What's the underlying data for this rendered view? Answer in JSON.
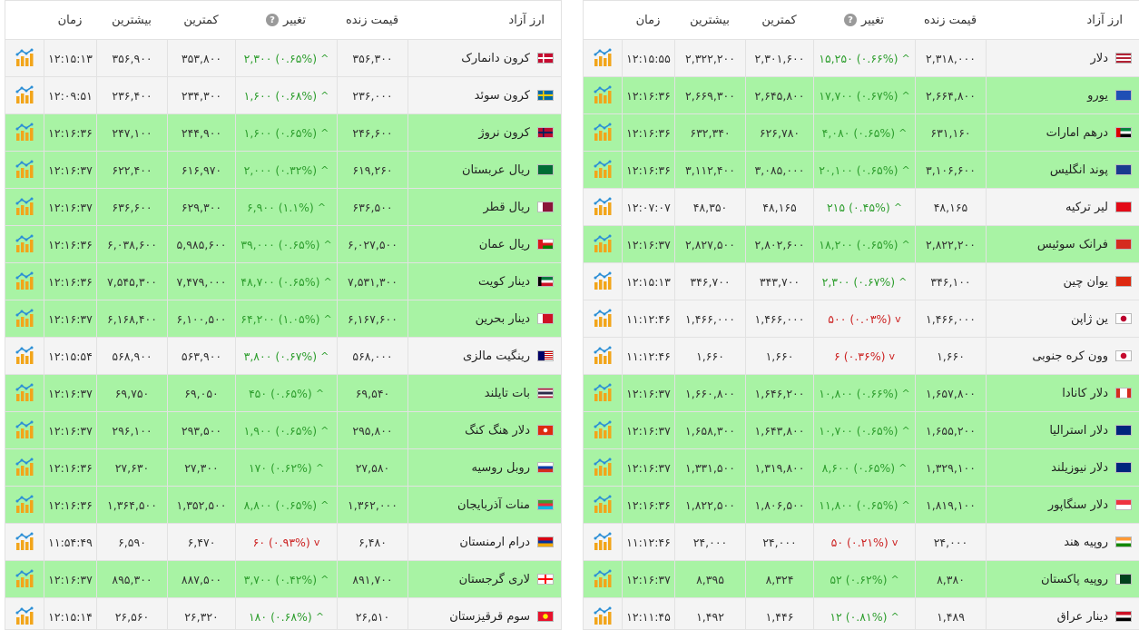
{
  "headers": {
    "name": "ارز آزاد",
    "live": "قیمت زنده",
    "change": "تغییر",
    "low": "کمترین",
    "high": "بیشترین",
    "time": "زمان"
  },
  "colors": {
    "up_row": "#a8f3a4",
    "up_text": "#2e9e2e",
    "down_text": "#cc2222",
    "flat_row": "#f4f4f4"
  },
  "right_table": [
    {
      "name": "دلار",
      "flag": "us-flag",
      "live": "۲,۳۱۸,۰۰۰",
      "change": "۱۵,۲۵۰ (۰.۶۶%)",
      "dir": "up",
      "low": "۲,۳۰۱,۶۰۰",
      "high": "۲,۳۲۲,۲۰۰",
      "time": "۱۲:۱۵:۵۵",
      "bg": "flat"
    },
    {
      "name": "یورو",
      "flag": "eu-flag",
      "live": "۲,۶۶۴,۸۰۰",
      "change": "۱۷,۷۰۰ (۰.۶۷%)",
      "dir": "up",
      "low": "۲,۶۴۵,۸۰۰",
      "high": "۲,۶۶۹,۳۰۰",
      "time": "۱۲:۱۶:۳۶",
      "bg": "up"
    },
    {
      "name": "درهم امارات",
      "flag": "ae-flag",
      "live": "۶۳۱,۱۶۰",
      "change": "۴,۰۸۰ (۰.۶۵%)",
      "dir": "up",
      "low": "۶۲۶,۷۸۰",
      "high": "۶۳۲,۳۴۰",
      "time": "۱۲:۱۶:۳۶",
      "bg": "up"
    },
    {
      "name": "پوند انگلیس",
      "flag": "gb-flag",
      "live": "۳,۱۰۶,۶۰۰",
      "change": "۲۰,۱۰۰ (۰.۶۵%)",
      "dir": "up",
      "low": "۳,۰۸۵,۰۰۰",
      "high": "۳,۱۱۲,۴۰۰",
      "time": "۱۲:۱۶:۳۶",
      "bg": "up"
    },
    {
      "name": "لیر ترکیه",
      "flag": "tr-flag",
      "live": "۴۸,۱۶۵",
      "change": "۲۱۵ (۰.۴۵%)",
      "dir": "up",
      "low": "۴۸,۱۶۵",
      "high": "۴۸,۳۵۰",
      "time": "۱۲:۰۷:۰۷",
      "bg": "flat"
    },
    {
      "name": "فرانک سوئیس",
      "flag": "ch-flag",
      "live": "۲,۸۲۲,۲۰۰",
      "change": "۱۸,۲۰۰ (۰.۶۵%)",
      "dir": "up",
      "low": "۲,۸۰۲,۶۰۰",
      "high": "۲,۸۲۷,۵۰۰",
      "time": "۱۲:۱۶:۳۷",
      "bg": "up"
    },
    {
      "name": "یوان چین",
      "flag": "cn-flag",
      "live": "۳۴۶,۱۰۰",
      "change": "۲,۳۰۰ (۰.۶۷%)",
      "dir": "up",
      "low": "۳۴۳,۷۰۰",
      "high": "۳۴۶,۷۰۰",
      "time": "۱۲:۱۵:۱۳",
      "bg": "flat"
    },
    {
      "name": "ین ژاپن",
      "flag": "jp-flag",
      "live": "۱,۴۶۶,۰۰۰",
      "change": "۵۰۰ (۰.۰۳%)",
      "dir": "down",
      "low": "۱,۴۶۶,۰۰۰",
      "high": "۱,۴۶۶,۰۰۰",
      "time": "۱۱:۱۲:۴۶",
      "bg": "flat"
    },
    {
      "name": "وون کره جنوبی",
      "flag": "kr-flag",
      "live": "۱,۶۶۰",
      "change": "۶ (۰.۳۶%)",
      "dir": "down",
      "low": "۱,۶۶۰",
      "high": "۱,۶۶۰",
      "time": "۱۱:۱۲:۴۶",
      "bg": "flat"
    },
    {
      "name": "دلار کانادا",
      "flag": "ca-flag",
      "live": "۱,۶۵۷,۸۰۰",
      "change": "۱۰,۸۰۰ (۰.۶۶%)",
      "dir": "up",
      "low": "۱,۶۴۶,۲۰۰",
      "high": "۱,۶۶۰,۸۰۰",
      "time": "۱۲:۱۶:۳۷",
      "bg": "up"
    },
    {
      "name": "دلار استرالیا",
      "flag": "au-flag",
      "live": "۱,۶۵۵,۲۰۰",
      "change": "۱۰,۷۰۰ (۰.۶۵%)",
      "dir": "up",
      "low": "۱,۶۴۳,۸۰۰",
      "high": "۱,۶۵۸,۳۰۰",
      "time": "۱۲:۱۶:۳۷",
      "bg": "up"
    },
    {
      "name": "دلار نیوزیلند",
      "flag": "nz-flag",
      "live": "۱,۳۲۹,۱۰۰",
      "change": "۸,۶۰۰ (۰.۶۵%)",
      "dir": "up",
      "low": "۱,۳۱۹,۸۰۰",
      "high": "۱,۳۳۱,۵۰۰",
      "time": "۱۲:۱۶:۳۷",
      "bg": "up"
    },
    {
      "name": "دلار سنگاپور",
      "flag": "sg-flag",
      "live": "۱,۸۱۹,۱۰۰",
      "change": "۱۱,۸۰۰ (۰.۶۵%)",
      "dir": "up",
      "low": "۱,۸۰۶,۵۰۰",
      "high": "۱,۸۲۲,۵۰۰",
      "time": "۱۲:۱۶:۳۶",
      "bg": "up"
    },
    {
      "name": "روپیه هند",
      "flag": "in-flag",
      "live": "۲۴,۰۰۰",
      "change": "۵۰ (۰.۲۱%)",
      "dir": "down",
      "low": "۲۴,۰۰۰",
      "high": "۲۴,۰۰۰",
      "time": "۱۱:۱۲:۴۶",
      "bg": "flat"
    },
    {
      "name": "روپیه پاکستان",
      "flag": "pk-flag",
      "live": "۸,۳۸۰",
      "change": "۵۲ (۰.۶۲%)",
      "dir": "up",
      "low": "۸,۳۲۴",
      "high": "۸,۳۹۵",
      "time": "۱۲:۱۶:۳۷",
      "bg": "up"
    },
    {
      "name": "دینار عراق",
      "flag": "iq-flag",
      "live": "۱,۴۸۹",
      "change": "۱۲ (۰.۸۱%)",
      "dir": "up",
      "low": "۱,۴۴۶",
      "high": "۱,۴۹۲",
      "time": "۱۲:۱۱:۴۵",
      "bg": "flat"
    }
  ],
  "left_table": [
    {
      "name": "کرون دانمارک",
      "flag": "dk-flag",
      "live": "۳۵۶,۳۰۰",
      "change": "۲,۳۰۰ (۰.۶۵%)",
      "dir": "up",
      "low": "۳۵۳,۸۰۰",
      "high": "۳۵۶,۹۰۰",
      "time": "۱۲:۱۵:۱۳",
      "bg": "flat"
    },
    {
      "name": "کرون سوئد",
      "flag": "se-flag",
      "live": "۲۳۶,۰۰۰",
      "change": "۱,۶۰۰ (۰.۶۸%)",
      "dir": "up",
      "low": "۲۳۴,۳۰۰",
      "high": "۲۳۶,۴۰۰",
      "time": "۱۲:۰۹:۵۱",
      "bg": "flat"
    },
    {
      "name": "کرون نروژ",
      "flag": "no-flag",
      "live": "۲۴۶,۶۰۰",
      "change": "۱,۶۰۰ (۰.۶۵%)",
      "dir": "up",
      "low": "۲۴۴,۹۰۰",
      "high": "۲۴۷,۱۰۰",
      "time": "۱۲:۱۶:۳۶",
      "bg": "up"
    },
    {
      "name": "ریال عربستان",
      "flag": "sa-flag",
      "live": "۶۱۹,۲۶۰",
      "change": "۲,۰۰۰ (۰.۳۲%)",
      "dir": "up",
      "low": "۶۱۶,۹۷۰",
      "high": "۶۲۲,۴۰۰",
      "time": "۱۲:۱۶:۳۷",
      "bg": "up"
    },
    {
      "name": "ریال قطر",
      "flag": "qa-flag",
      "live": "۶۳۶,۵۰۰",
      "change": "۶,۹۰۰ (۱.۱%)",
      "dir": "up",
      "low": "۶۲۹,۳۰۰",
      "high": "۶۳۶,۶۰۰",
      "time": "۱۲:۱۶:۳۷",
      "bg": "up"
    },
    {
      "name": "ریال عمان",
      "flag": "om-flag",
      "live": "۶,۰۲۷,۵۰۰",
      "change": "۳۹,۰۰۰ (۰.۶۵%)",
      "dir": "up",
      "low": "۵,۹۸۵,۶۰۰",
      "high": "۶,۰۳۸,۶۰۰",
      "time": "۱۲:۱۶:۳۶",
      "bg": "up"
    },
    {
      "name": "دینار کویت",
      "flag": "kw-flag",
      "live": "۷,۵۳۱,۳۰۰",
      "change": "۴۸,۷۰۰ (۰.۶۵%)",
      "dir": "up",
      "low": "۷,۴۷۹,۰۰۰",
      "high": "۷,۵۴۵,۳۰۰",
      "time": "۱۲:۱۶:۳۶",
      "bg": "up"
    },
    {
      "name": "دینار بحرین",
      "flag": "bh-flag",
      "live": "۶,۱۶۷,۶۰۰",
      "change": "۶۴,۲۰۰ (۱.۰۵%)",
      "dir": "up",
      "low": "۶,۱۰۰,۵۰۰",
      "high": "۶,۱۶۸,۴۰۰",
      "time": "۱۲:۱۶:۳۷",
      "bg": "up"
    },
    {
      "name": "رینگیت مالزی",
      "flag": "my-flag",
      "live": "۵۶۸,۰۰۰",
      "change": "۳,۸۰۰ (۰.۶۷%)",
      "dir": "up",
      "low": "۵۶۳,۹۰۰",
      "high": "۵۶۸,۹۰۰",
      "time": "۱۲:۱۵:۵۴",
      "bg": "flat"
    },
    {
      "name": "بات تایلند",
      "flag": "th-flag",
      "live": "۶۹,۵۴۰",
      "change": "۴۵۰ (۰.۶۵%)",
      "dir": "up",
      "low": "۶۹,۰۵۰",
      "high": "۶۹,۷۵۰",
      "time": "۱۲:۱۶:۳۷",
      "bg": "up"
    },
    {
      "name": "دلار هنگ کنگ",
      "flag": "hk-flag",
      "live": "۲۹۵,۸۰۰",
      "change": "۱,۹۰۰ (۰.۶۵%)",
      "dir": "up",
      "low": "۲۹۳,۵۰۰",
      "high": "۲۹۶,۱۰۰",
      "time": "۱۲:۱۶:۳۷",
      "bg": "up"
    },
    {
      "name": "روبل روسیه",
      "flag": "ru-flag",
      "live": "۲۷,۵۸۰",
      "change": "۱۷۰ (۰.۶۲%)",
      "dir": "up",
      "low": "۲۷,۳۰۰",
      "high": "۲۷,۶۳۰",
      "time": "۱۲:۱۶:۳۶",
      "bg": "up"
    },
    {
      "name": "منات آذربایجان",
      "flag": "az-flag",
      "live": "۱,۳۶۲,۰۰۰",
      "change": "۸,۸۰۰ (۰.۶۵%)",
      "dir": "up",
      "low": "۱,۳۵۲,۵۰۰",
      "high": "۱,۳۶۴,۵۰۰",
      "time": "۱۲:۱۶:۳۶",
      "bg": "up"
    },
    {
      "name": "درام ارمنستان",
      "flag": "am-flag",
      "live": "۶,۴۸۰",
      "change": "۶۰ (۰.۹۳%)",
      "dir": "down",
      "low": "۶,۴۷۰",
      "high": "۶,۵۹۰",
      "time": "۱۱:۵۴:۴۹",
      "bg": "flat"
    },
    {
      "name": "لاری گرجستان",
      "flag": "ge-flag",
      "live": "۸۹۱,۷۰۰",
      "change": "۳,۷۰۰ (۰.۴۲%)",
      "dir": "up",
      "low": "۸۸۷,۵۰۰",
      "high": "۸۹۵,۳۰۰",
      "time": "۱۲:۱۶:۳۷",
      "bg": "up"
    },
    {
      "name": "سوم قرقیزستان",
      "flag": "kg-flag",
      "live": "۲۶,۵۱۰",
      "change": "۱۸۰ (۰.۶۸%)",
      "dir": "up",
      "low": "۲۶,۳۲۰",
      "high": "۲۶,۵۶۰",
      "time": "۱۲:۱۵:۱۴",
      "bg": "flat"
    }
  ]
}
